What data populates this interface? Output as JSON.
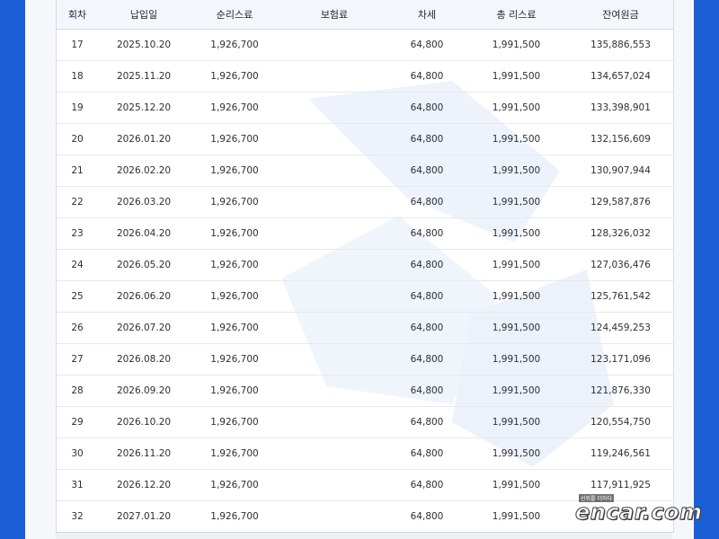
{
  "table": {
    "headers": [
      "회차",
      "납입일",
      "순리스료",
      "보험료",
      "차세",
      "총 리스료",
      "잔여원금"
    ],
    "rows": [
      [
        "17",
        "2025.10.20",
        "1,926,700",
        "",
        "64,800",
        "1,991,500",
        "135,886,553"
      ],
      [
        "18",
        "2025.11.20",
        "1,926,700",
        "",
        "64,800",
        "1,991,500",
        "134,657,024"
      ],
      [
        "19",
        "2025.12.20",
        "1,926,700",
        "",
        "64,800",
        "1,991,500",
        "133,398,901"
      ],
      [
        "20",
        "2026.01.20",
        "1,926,700",
        "",
        "64,800",
        "1,991,500",
        "132,156,609"
      ],
      [
        "21",
        "2026.02.20",
        "1,926,700",
        "",
        "64,800",
        "1,991,500",
        "130,907,944"
      ],
      [
        "22",
        "2026.03.20",
        "1,926,700",
        "",
        "64,800",
        "1,991,500",
        "129,587,876"
      ],
      [
        "23",
        "2026.04.20",
        "1,926,700",
        "",
        "64,800",
        "1,991,500",
        "128,326,032"
      ],
      [
        "24",
        "2026.05.20",
        "1,926,700",
        "",
        "64,800",
        "1,991,500",
        "127,036,476"
      ],
      [
        "25",
        "2026.06.20",
        "1,926,700",
        "",
        "64,800",
        "1,991,500",
        "125,761,542"
      ],
      [
        "26",
        "2026.07.20",
        "1,926,700",
        "",
        "64,800",
        "1,991,500",
        "124,459,253"
      ],
      [
        "27",
        "2026.08.20",
        "1,926,700",
        "",
        "64,800",
        "1,991,500",
        "123,171,096"
      ],
      [
        "28",
        "2026.09.20",
        "1,926,700",
        "",
        "64,800",
        "1,991,500",
        "121,876,330"
      ],
      [
        "29",
        "2026.10.20",
        "1,926,700",
        "",
        "64,800",
        "1,991,500",
        "120,554,750"
      ],
      [
        "30",
        "2026.11.20",
        "1,926,700",
        "",
        "64,800",
        "1,991,500",
        "119,246,561"
      ],
      [
        "31",
        "2026.12.20",
        "1,926,700",
        "",
        "64,800",
        "1,991,500",
        "117,911,925"
      ],
      [
        "32",
        "2027.01.20",
        "1,926,700",
        "",
        "64,800",
        "1,991,500",
        ""
      ]
    ]
  },
  "watermark_logo": {
    "tagline": "신뢰를 더하다",
    "text": "encar.com"
  },
  "colors": {
    "frame_blue": "#1b5fd6",
    "header_bg": "#f3f6fa",
    "watermark": "#e8eef8"
  }
}
